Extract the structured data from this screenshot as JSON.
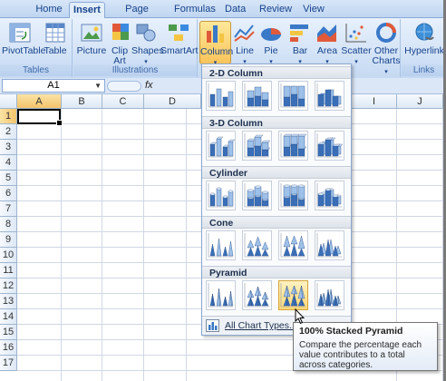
{
  "tabs": [
    {
      "label": "Home"
    },
    {
      "label": "Insert"
    },
    {
      "label": "Page Layout"
    },
    {
      "label": "Formulas"
    },
    {
      "label": "Data"
    },
    {
      "label": "Review"
    },
    {
      "label": "View"
    }
  ],
  "active_tab": "Insert",
  "groups": {
    "tables": {
      "label": "Tables",
      "buttons": [
        {
          "label": "PivotTable",
          "icon": "pivottable-icon"
        },
        {
          "label": "Table",
          "icon": "table-icon"
        }
      ]
    },
    "illustrations": {
      "label": "Illustrations",
      "buttons": [
        {
          "label": "Picture",
          "icon": "picture-icon"
        },
        {
          "label": "Clip Art",
          "icon": "clipart-icon"
        },
        {
          "label": "Shapes",
          "icon": "shapes-icon"
        },
        {
          "label": "SmartArt",
          "icon": "smartart-icon"
        }
      ]
    },
    "charts": {
      "buttons": [
        {
          "label": "Column",
          "icon": "column-chart-icon"
        },
        {
          "label": "Line",
          "icon": "line-chart-icon"
        },
        {
          "label": "Pie",
          "icon": "pie-chart-icon"
        },
        {
          "label": "Bar",
          "icon": "bar-chart-icon"
        },
        {
          "label": "Area",
          "icon": "area-chart-icon"
        },
        {
          "label": "Scatter",
          "icon": "scatter-chart-icon"
        },
        {
          "label": "Other Charts",
          "icon": "other-charts-icon"
        }
      ]
    },
    "links": {
      "label": "Links",
      "buttons": [
        {
          "label": "Hyperlink",
          "icon": "hyperlink-icon"
        }
      ]
    }
  },
  "formula_bar": {
    "name_box": "A1",
    "fx": "fx",
    "formula": ""
  },
  "columns": [
    "A",
    "B",
    "C",
    "D",
    "I",
    "J"
  ],
  "rows": [
    "1",
    "2",
    "3",
    "4",
    "5",
    "6",
    "7",
    "8",
    "9",
    "10",
    "11",
    "12",
    "13",
    "14",
    "15",
    "16",
    "17"
  ],
  "gallery": {
    "sections": [
      {
        "title": "2-D Column"
      },
      {
        "title": "3-D Column"
      },
      {
        "title": "Cylinder"
      },
      {
        "title": "Cone"
      },
      {
        "title": "Pyramid"
      }
    ],
    "footer": "All Chart Types..."
  },
  "tooltip": {
    "title": "100% Stacked Pyramid",
    "body": "Compare the percentage each value contributes to a total across categories."
  },
  "colors": {
    "accent": "#f9c45a",
    "ribbon": "#d5e4f7",
    "header_text": "#15428b"
  }
}
